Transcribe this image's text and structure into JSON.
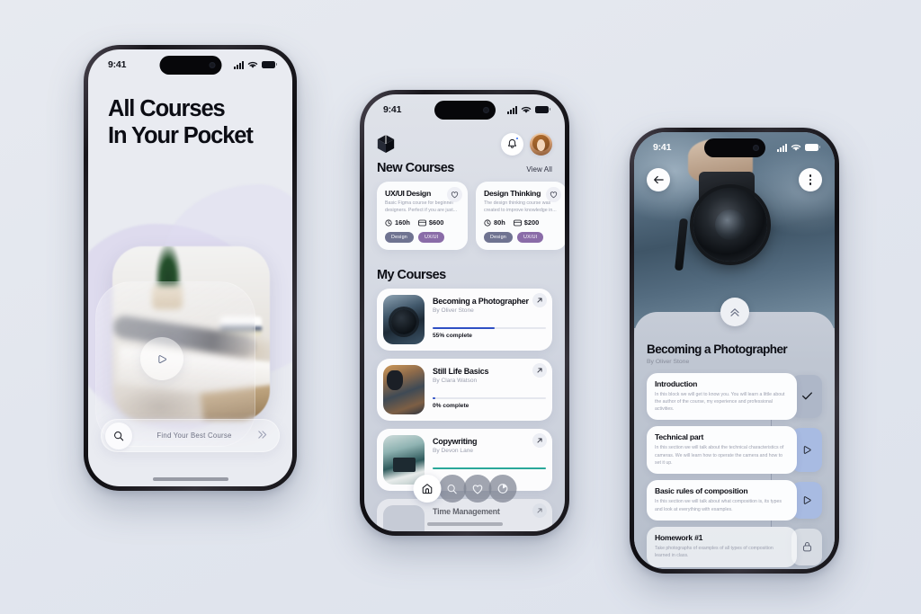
{
  "background": {
    "color_top": "#e7eaf0",
    "color_bottom": "#dde2ec"
  },
  "phone1": {
    "name": "onboarding-screen",
    "status": {
      "time": "9:41",
      "signal_icon": "cellular-signal-icon",
      "wifi_icon": "wifi-icon",
      "battery_icon": "battery-icon"
    },
    "headline_line1": "All Courses",
    "headline_line2": "In Your Pocket",
    "play_icon": "play-icon",
    "search": {
      "icon": "search-icon",
      "placeholder": "Find Your Best Course",
      "chevron_icon": "double-chevron-right-icon"
    }
  },
  "phone2": {
    "name": "home-screen",
    "status": {
      "time": "9:41"
    },
    "header": {
      "logo_icon": "cube-logo-icon",
      "bell_icon": "bell-notification-icon",
      "avatar": "user-avatar"
    },
    "new_courses": {
      "title": "New Courses",
      "view_all": "View All",
      "cards": [
        {
          "title": "UX/UI Design",
          "desc": "Basic Figma course for beginner designers. Perfect if you are just...",
          "duration": "160h",
          "price": "$600",
          "tags": [
            "Design",
            "UX/UI"
          ],
          "heart_icon": "heart-outline-icon",
          "clock_icon": "clock-icon",
          "card_icon": "credit-card-icon"
        },
        {
          "title": "Design Thinking",
          "desc": "The design thinking course was created to improve knowledge in...",
          "duration": "80h",
          "price": "$200",
          "tags": [
            "Design",
            "UX/UI"
          ],
          "heart_icon": "heart-outline-icon",
          "clock_icon": "clock-icon",
          "card_icon": "credit-card-icon"
        }
      ]
    },
    "my_courses": {
      "title": "My Courses",
      "cards": [
        {
          "title": "Becoming a Photographer",
          "author": "By Oliver Stone",
          "progress": 55,
          "progress_label": "55% complete",
          "arrow_icon": "arrow-up-right-icon"
        },
        {
          "title": "Still Life Basics",
          "author": "By Clara Watson",
          "progress": 0,
          "progress_label": "0% complete",
          "arrow_icon": "arrow-up-right-icon"
        },
        {
          "title": "Copywriting",
          "author": "By Devon Lane",
          "progress": 100,
          "progress_label": "",
          "arrow_icon": "arrow-up-right-icon"
        },
        {
          "title": "Time Management",
          "author": "",
          "progress": 0,
          "progress_label": "",
          "arrow_icon": "arrow-up-right-icon"
        }
      ]
    },
    "nav": [
      {
        "icon": "home-icon",
        "active": true
      },
      {
        "icon": "search-icon",
        "active": false
      },
      {
        "icon": "heart-icon",
        "active": false
      },
      {
        "icon": "pie-chart-icon",
        "active": false
      }
    ]
  },
  "phone3": {
    "name": "course-detail-screen",
    "status": {
      "time": "9:41"
    },
    "back_icon": "arrow-left-icon",
    "menu_icon": "more-vertical-icon",
    "pull_icon": "double-chevron-up-icon",
    "course_title": "Becoming a Photographer",
    "course_author": "By Oliver Stone",
    "lessons": [
      {
        "title": "Introduction",
        "desc": "In this block we will get to know you. You will learn a little about the author of the course, my experience and professional activities.",
        "state": "done",
        "action_icon": "check-icon"
      },
      {
        "title": "Technical part",
        "desc": "In this section we will talk about the technical characteristics of cameras. We will learn how to operate the camera and how to set it up.",
        "state": "play",
        "action_icon": "play-icon"
      },
      {
        "title": "Basic rules of composition",
        "desc": "In this section we will talk about what composition is, its types and look at everything with examples.",
        "state": "play",
        "action_icon": "play-icon"
      },
      {
        "title": "Homework #1",
        "desc": "Take photographs of examples of all types of composition learned in class.",
        "state": "locked",
        "action_icon": "lock-icon"
      }
    ]
  }
}
